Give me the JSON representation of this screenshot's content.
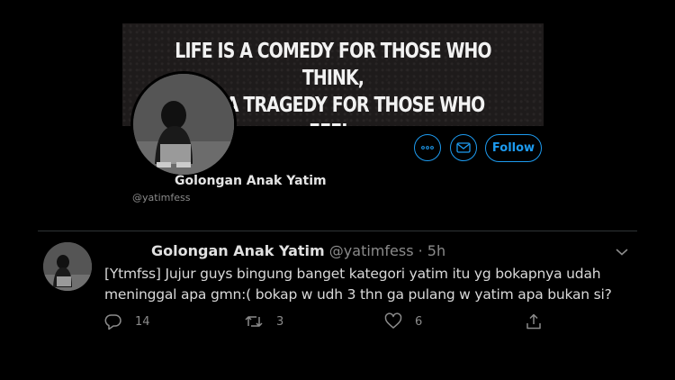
{
  "banner": {
    "line1": "LIFE IS A COMEDY FOR THOSE WHO THINK,",
    "line2": "AND A TRAGEDY FOR THOSE WHO FEEL."
  },
  "profile": {
    "name": "Golongan Anak Yatim",
    "handle": "@yatimfess",
    "follow_label": "Follow",
    "more_icon": "more-icon",
    "message_icon": "mail-icon"
  },
  "tweet": {
    "name": "Golongan Anak Yatim",
    "meta": "@yatimfess · 5h",
    "text": "[Ytmfss] Jujur guys bingung banget kategori yatim itu yg bokapnya udah meninggal apa gmn:( bokap w udh 3 thn ga pulang w yatim apa bukan si?",
    "replies": "14",
    "retweets": "3",
    "likes": "6"
  },
  "colors": {
    "accent": "#1d9bf0",
    "background": "#000000",
    "muted": "#8b8b8b"
  }
}
